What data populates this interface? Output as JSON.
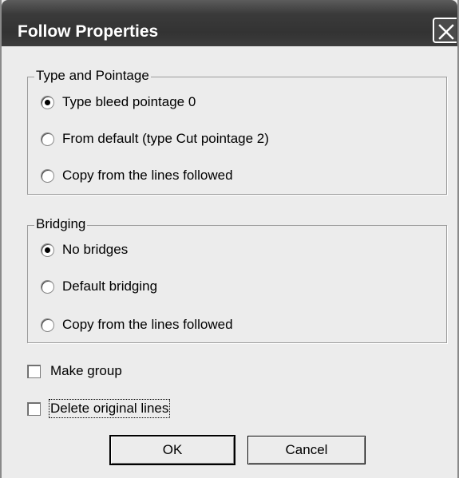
{
  "window": {
    "title": "Follow Properties"
  },
  "type_pointage": {
    "legend": "Type and Pointage",
    "options": [
      {
        "label": "Type bleed pointage 0",
        "checked": true
      },
      {
        "label": "From default (type Cut pointage 2)",
        "checked": false
      },
      {
        "label": "Copy from the lines followed",
        "checked": false
      }
    ]
  },
  "bridging": {
    "legend": "Bridging",
    "options": [
      {
        "label": "No bridges",
        "checked": true
      },
      {
        "label": "Default bridging",
        "checked": false
      },
      {
        "label": "Copy from the lines followed",
        "checked": false
      }
    ]
  },
  "checkboxes": {
    "make_group": {
      "label": "Make group",
      "checked": false
    },
    "delete_original": {
      "label": "Delete original lines",
      "checked": false
    }
  },
  "buttons": {
    "ok_label": "OK",
    "cancel_label": "Cancel"
  }
}
